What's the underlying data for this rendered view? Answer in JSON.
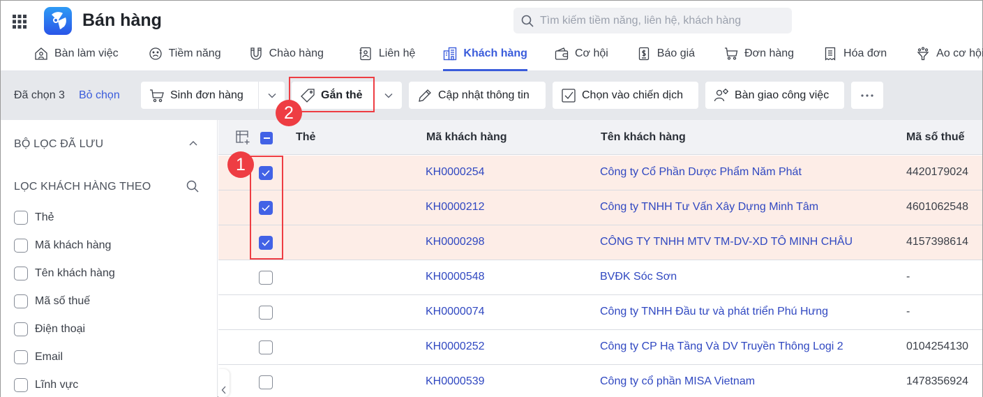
{
  "header": {
    "app_title": "Bán hàng",
    "search_placeholder": "Tìm kiếm tiềm năng, liên hệ, khách hàng",
    "search_value": ""
  },
  "nav": {
    "items": [
      {
        "label": "Bàn làm việc",
        "icon": "home-icon"
      },
      {
        "label": "Tiềm năng",
        "icon": "face-icon"
      },
      {
        "label": "Chào hàng",
        "icon": "magnet-icon"
      },
      {
        "label": "Liên hệ",
        "icon": "contact-card-icon"
      },
      {
        "label": "Khách hàng",
        "icon": "building-icon",
        "active": true
      },
      {
        "label": "Cơ hội",
        "icon": "wallet-icon"
      },
      {
        "label": "Báo giá",
        "icon": "dollar-doc-icon"
      },
      {
        "label": "Đơn hàng",
        "icon": "cart-icon"
      },
      {
        "label": "Hóa đơn",
        "icon": "receipt-icon"
      },
      {
        "label": "Ao cơ hội",
        "icon": "funnel-icon"
      }
    ]
  },
  "actionbar": {
    "selected_label": "Đã chọn 3",
    "deselect_label": "Bỏ chọn",
    "buttons": {
      "create_order": "Sinh đơn hàng",
      "tag": "Gắn thẻ",
      "update_info": "Cập nhật thông tin",
      "add_to_campaign": "Chọn vào chiến dịch",
      "handover": "Bàn giao công việc",
      "more": "···"
    }
  },
  "annotations": {
    "step1": "1",
    "step2": "2",
    "color": "#ee3d43"
  },
  "sidebar": {
    "saved_filters_title": "BỘ LỌC ĐÃ LƯU",
    "filter_by_title": "LỌC KHÁCH HÀNG THEO",
    "filters": [
      {
        "label": "Thẻ",
        "checked": false
      },
      {
        "label": "Mã khách hàng",
        "checked": false
      },
      {
        "label": "Tên khách hàng",
        "checked": false
      },
      {
        "label": "Mã số thuế",
        "checked": false
      },
      {
        "label": "Điện thoại",
        "checked": false
      },
      {
        "label": "Email",
        "checked": false
      },
      {
        "label": "Lĩnh vực",
        "checked": false
      }
    ]
  },
  "table": {
    "columns": [
      "Thẻ",
      "Mã khách hàng",
      "Tên khách hàng",
      "Mã số thuế"
    ],
    "rows": [
      {
        "selected": true,
        "tag": "",
        "code": "KH0000254",
        "name": "Công ty Cổ Phần Dược Phẩm Năm Phát",
        "tax": "4420179024"
      },
      {
        "selected": true,
        "tag": "",
        "code": "KH0000212",
        "name": "Công ty TNHH Tư Vấn Xây Dựng Minh Tâm",
        "tax": "4601062548"
      },
      {
        "selected": true,
        "tag": "",
        "code": "KH0000298",
        "name": "CÔNG TY TNHH MTV TM-DV-XD TÔ MINH CHÂU",
        "tax": "4157398614"
      },
      {
        "selected": false,
        "tag": "",
        "code": "KH0000548",
        "name": "BVĐK Sóc Sơn",
        "tax": "-"
      },
      {
        "selected": false,
        "tag": "",
        "code": "KH0000074",
        "name": "Công ty TNHH Đầu tư và phát triển Phú Hưng",
        "tax": "-"
      },
      {
        "selected": false,
        "tag": "",
        "code": "KH0000252",
        "name": "Công ty CP Hạ Tầng Và DV Truyền Thông Logi 2",
        "tax": "0104254130"
      },
      {
        "selected": false,
        "tag": "",
        "code": "KH0000539",
        "name": "Công ty cổ phần MISA Vietnam",
        "tax": "1478356924"
      }
    ]
  },
  "colors": {
    "accent": "#3a5cdb",
    "link": "#3048c1",
    "selected_row": "#fdede7",
    "checkbox": "#4262e6"
  }
}
